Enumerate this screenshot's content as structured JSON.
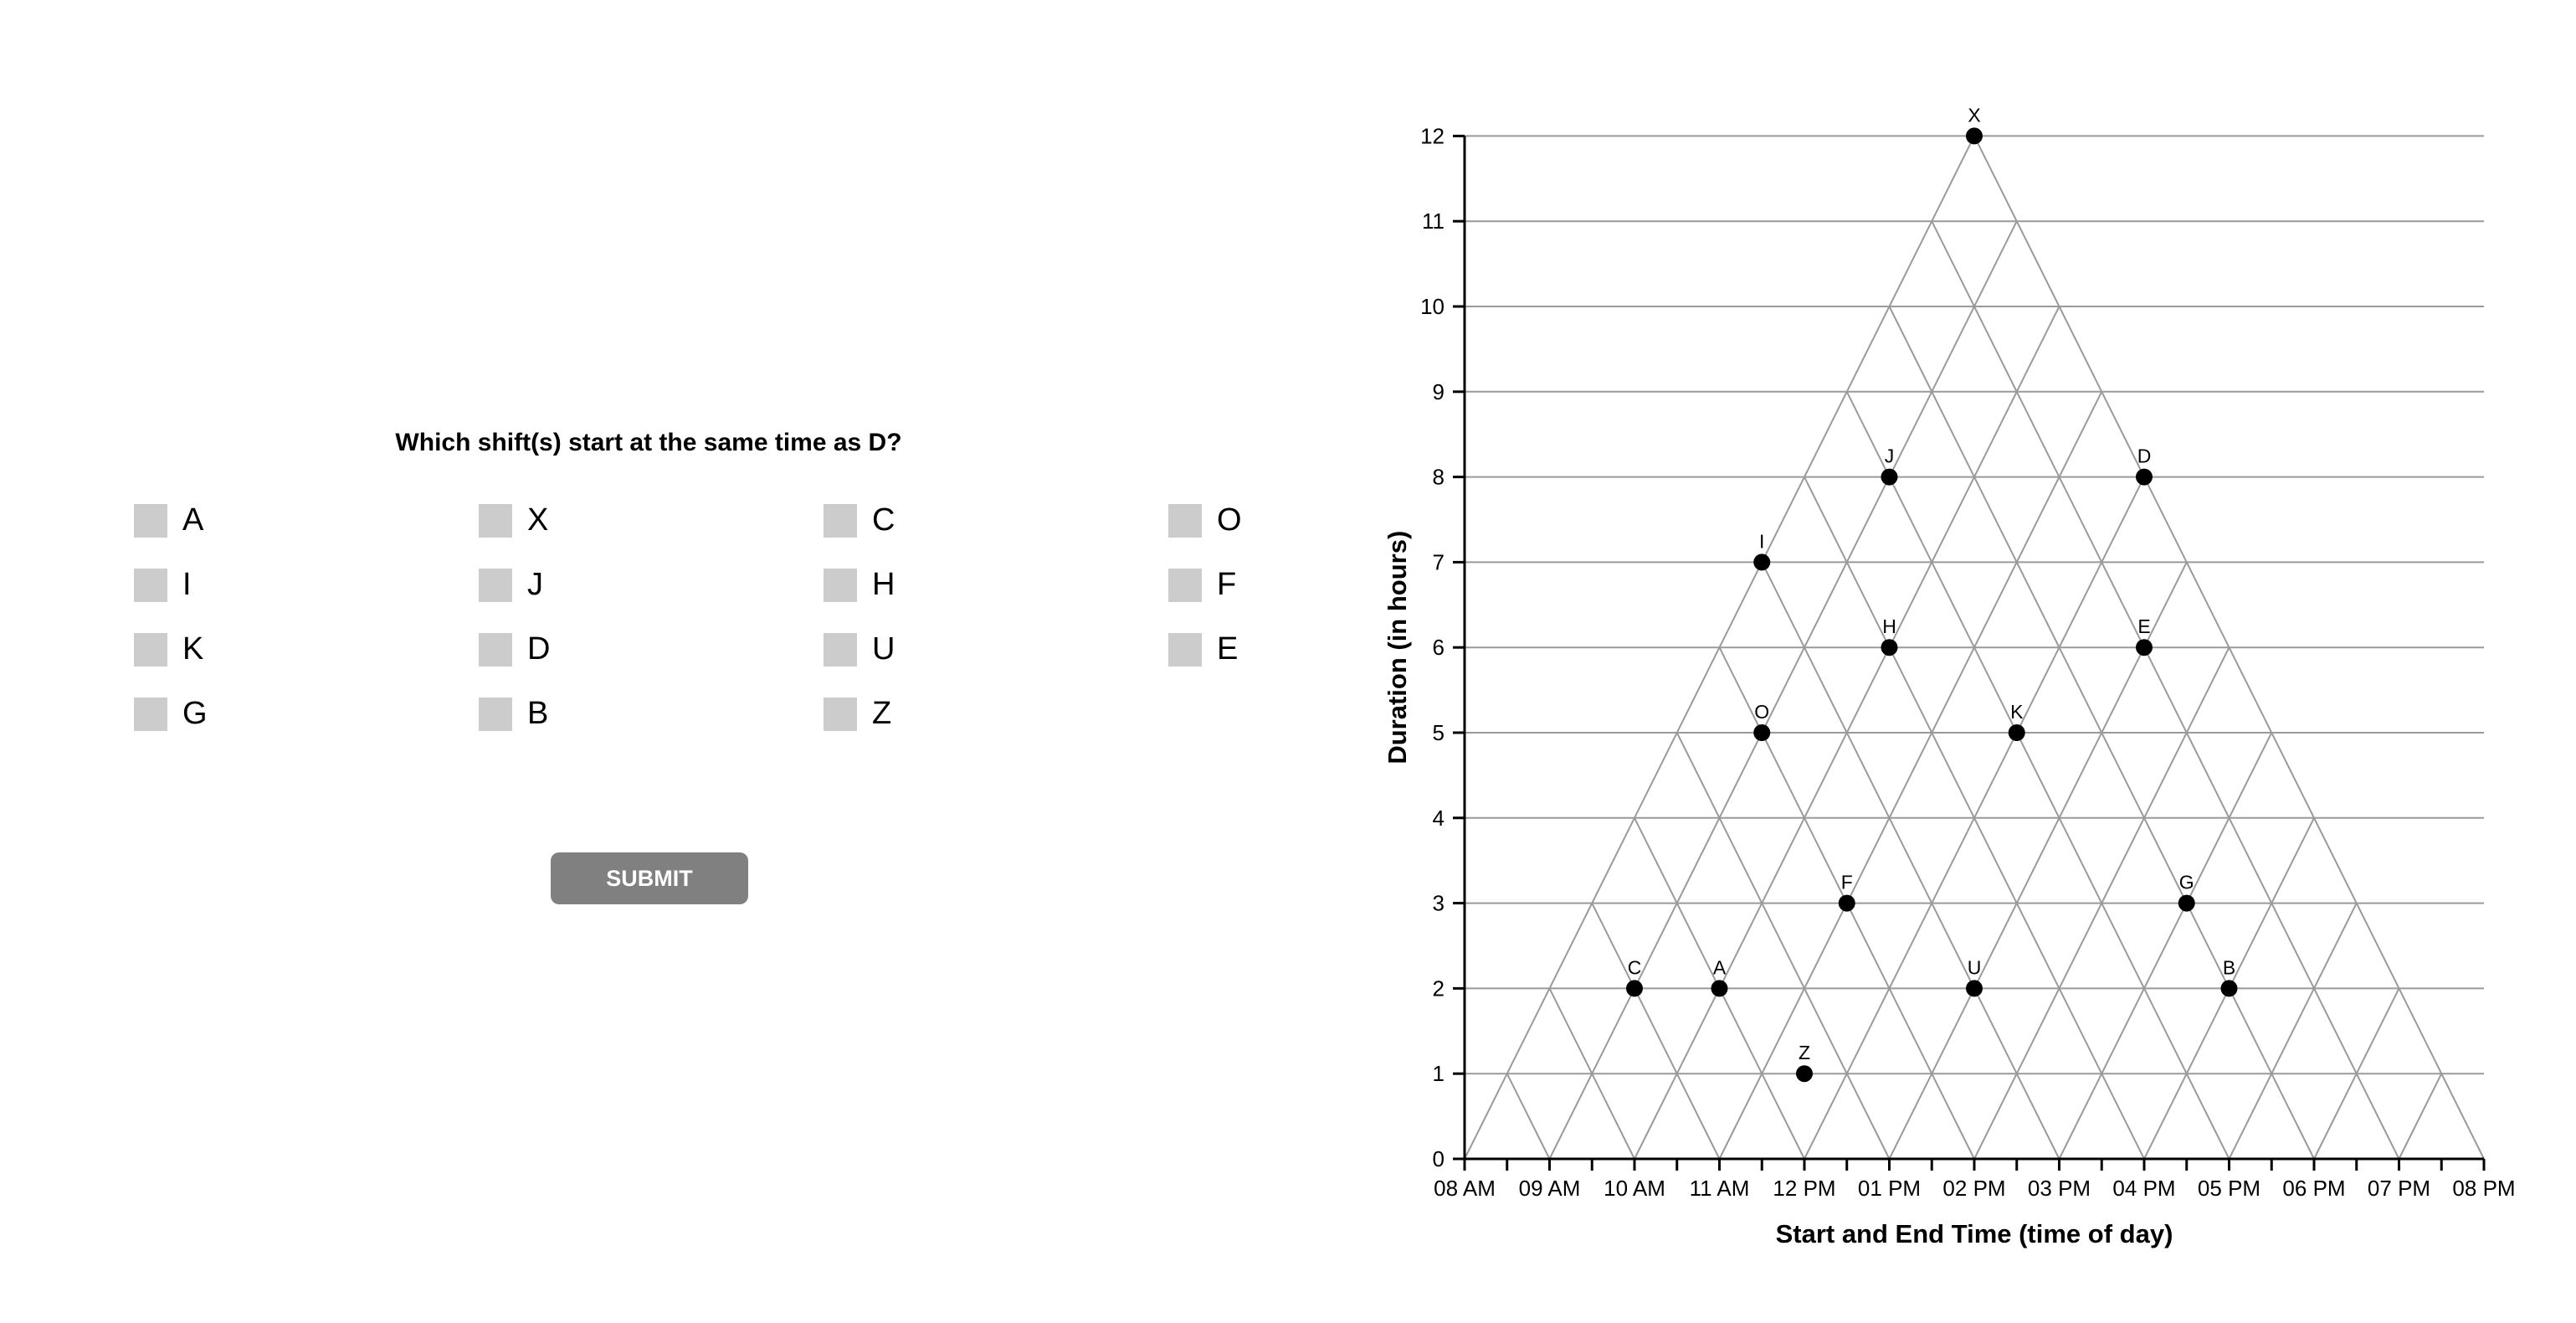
{
  "question": "Which shift(s) start at the same time as D?",
  "options": [
    [
      "A",
      "X",
      "C",
      "O"
    ],
    [
      "I",
      "J",
      "H",
      "F"
    ],
    [
      "K",
      "D",
      "U",
      "E"
    ],
    [
      "G",
      "B",
      "Z"
    ]
  ],
  "submit_label": "SUBMIT",
  "chart_data": {
    "type": "scatter",
    "title": "",
    "xlabel": "Start and End Time (time of day)",
    "ylabel": "Duration (in hours)",
    "x_ticks": [
      "08 AM",
      "09 AM",
      "10 AM",
      "11 AM",
      "12 PM",
      "01 PM",
      "02 PM",
      "03 PM",
      "04 PM",
      "05 PM",
      "06 PM",
      "07 PM",
      "08 PM"
    ],
    "y_ticks": [
      "0",
      "1",
      "2",
      "3",
      "4",
      "5",
      "6",
      "7",
      "8",
      "9",
      "10",
      "11",
      "12"
    ],
    "xlim": [
      "08 AM",
      "08 PM"
    ],
    "ylim": [
      0,
      12
    ],
    "grid": "triangular",
    "point_color": "#000000",
    "points": [
      {
        "label": "X",
        "x": "02 PM",
        "y": 12
      },
      {
        "label": "J",
        "x": "01 PM",
        "y": 8
      },
      {
        "label": "D",
        "x": "04 PM",
        "y": 8
      },
      {
        "label": "I",
        "x": "11:30 AM",
        "y": 7
      },
      {
        "label": "H",
        "x": "01 PM",
        "y": 6
      },
      {
        "label": "E",
        "x": "04 PM",
        "y": 6
      },
      {
        "label": "O",
        "x": "11:30 AM",
        "y": 5
      },
      {
        "label": "K",
        "x": "02:30 PM",
        "y": 5
      },
      {
        "label": "F",
        "x": "12:30 PM",
        "y": 3
      },
      {
        "label": "G",
        "x": "04:30 PM",
        "y": 3
      },
      {
        "label": "C",
        "x": "10 AM",
        "y": 2
      },
      {
        "label": "A",
        "x": "11 AM",
        "y": 2
      },
      {
        "label": "U",
        "x": "02 PM",
        "y": 2
      },
      {
        "label": "B",
        "x": "05 PM",
        "y": 2
      },
      {
        "label": "Z",
        "x": "12 PM",
        "y": 1
      }
    ]
  }
}
